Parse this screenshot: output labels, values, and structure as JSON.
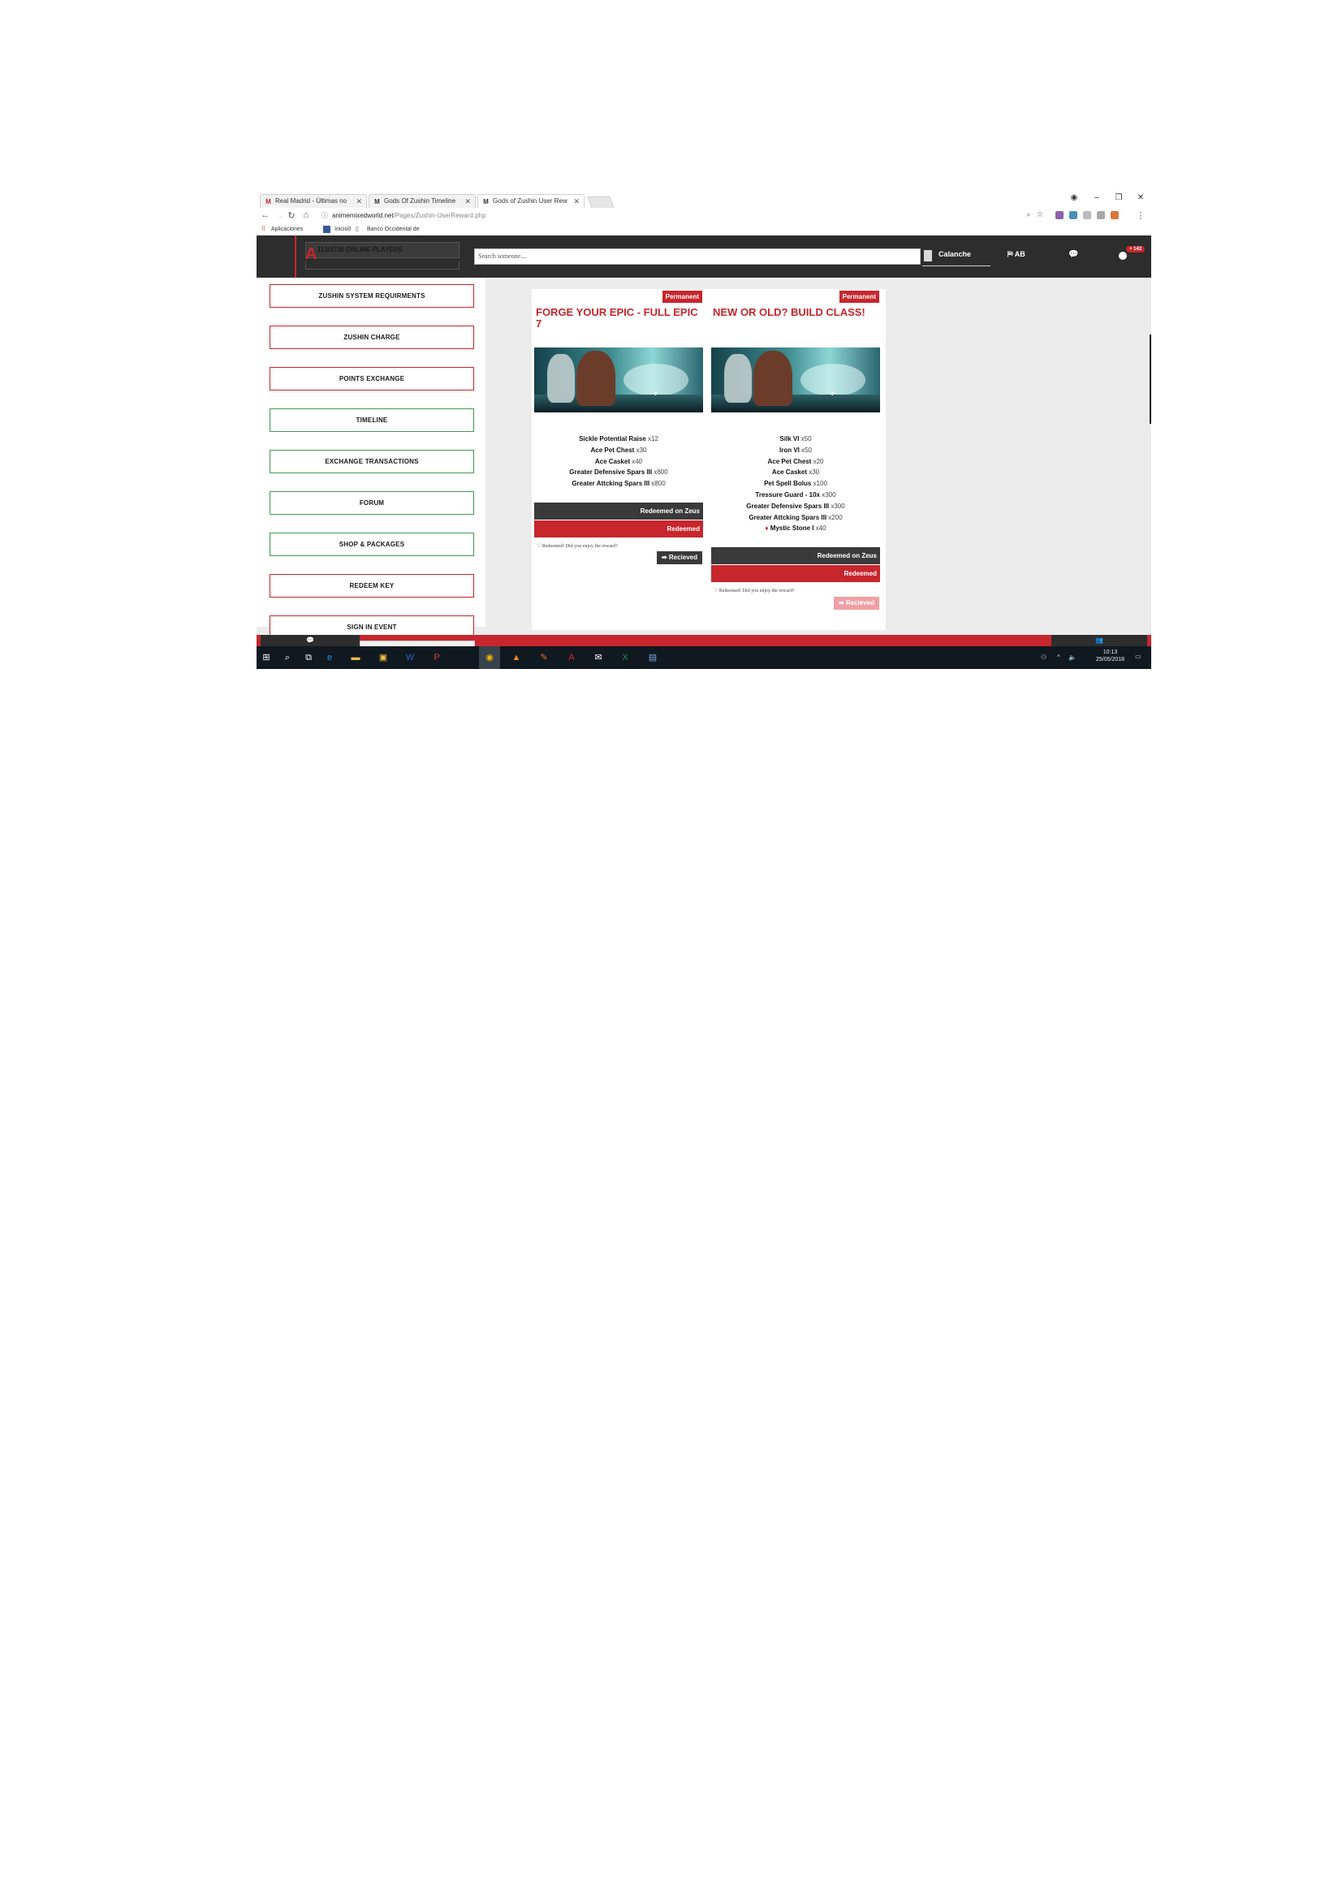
{
  "browser": {
    "tabs": [
      {
        "label": "Real Madrid - Últimas no",
        "icon": "real-madrid-favicon"
      },
      {
        "label": "Gods Of Zushin Timeline",
        "icon": "gz-favicon"
      },
      {
        "label": "Gods of Zushin User Rew",
        "icon": "gz-favicon"
      }
    ],
    "url_host": "animemixedworld.net",
    "url_path": "/Pages/Zushin-UserReward.php",
    "bookmarks": [
      "Aplicaciones",
      "Inicio0",
      "Banco Occidental de"
    ]
  },
  "header": {
    "online_text": "113/3736 ONLINE PLAYERS",
    "search_placeholder": "Search someone....",
    "username": "Calanche",
    "language": "AB",
    "notification_count": "142"
  },
  "sidebar": {
    "items": [
      {
        "label": "ZUSHIN SYSTEM REQUIRMENTS",
        "color": "red"
      },
      {
        "label": "ZUSHIN CHARGE",
        "color": "red"
      },
      {
        "label": "POINTS EXCHANGE",
        "color": "red"
      },
      {
        "label": "TIMELINE",
        "color": "green"
      },
      {
        "label": "EXCHANGE TRANSACTIONS",
        "color": "green"
      },
      {
        "label": "FORUM",
        "color": "green"
      },
      {
        "label": "SHOP & PACKAGES",
        "color": "green"
      },
      {
        "label": "REDEEM KEY",
        "color": "red"
      },
      {
        "label": "SIGN IN EVENT",
        "color": "red"
      }
    ]
  },
  "cards": [
    {
      "badge": "Permanent",
      "title": "FORGE YOUR EPIC - FULL EPIC 7",
      "items": [
        {
          "name": "Sickle Potential Raise",
          "qty": "x12"
        },
        {
          "name": "Ace Pet Chest",
          "qty": "x30"
        },
        {
          "name": "Ace Casket",
          "qty": "x40"
        },
        {
          "name": "Greater Defensive Spars III",
          "qty": "x800"
        },
        {
          "name": "Greater Attcking Spars III",
          "qty": "x800"
        }
      ],
      "redeemed_on": "Redeemed on Zeus",
      "status": "Redeemed",
      "enjoy": "Redeemed! Did you enjoy the reward?",
      "received": "Recieved"
    },
    {
      "badge": "Permanent",
      "title": "NEW OR OLD? BUILD CLASS!",
      "items": [
        {
          "name": "Silk VI",
          "qty": "x50"
        },
        {
          "name": "Iron VI",
          "qty": "x50"
        },
        {
          "name": "Ace Pet Chest",
          "qty": "x20"
        },
        {
          "name": "Ace Casket",
          "qty": "x30"
        },
        {
          "name": "Pet Spell Bolus",
          "qty": "x100"
        },
        {
          "name": "Tressure Guard - 10x",
          "qty": "x300"
        },
        {
          "name": "Greater Defensive Spars III",
          "qty": "x300"
        },
        {
          "name": "Greater Attcking Spars III",
          "qty": "x200"
        },
        {
          "name": "Mystic Stone I",
          "qty": "x40"
        }
      ],
      "redeemed_on": "Redeemed on Zeus",
      "status": "Redeemed",
      "enjoy": "Redeemed! Did you enjoy the reward?",
      "received": "Recieved"
    }
  ],
  "taskbar": {
    "time": "10:13",
    "date": "25/05/2018"
  },
  "colors": {
    "accent_red": "#c8262d",
    "accent_green": "#3e9b52",
    "header_bg": "#2d2d2d"
  }
}
